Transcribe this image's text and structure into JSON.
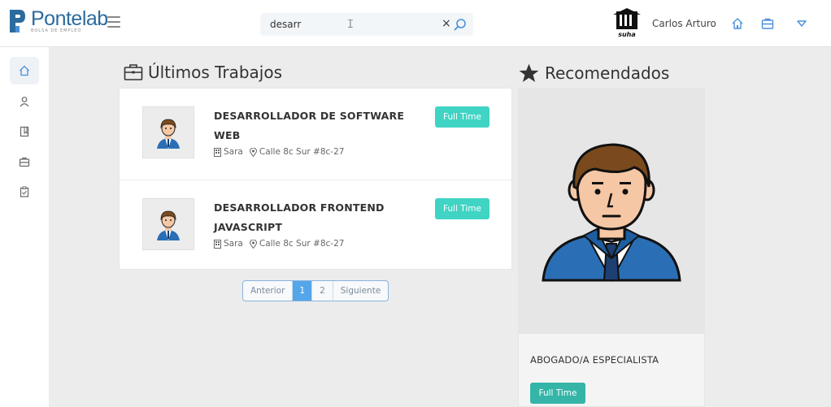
{
  "brand": {
    "name": "Pontelab",
    "tagline": "BOLSA DE EMPLEO"
  },
  "search": {
    "value": "desarr",
    "clear_symbol": "×"
  },
  "user": {
    "name": "Carlos Arturo",
    "avatar_text": "suha"
  },
  "colors": {
    "primary": "#2c6b9e",
    "accent_teal": "#3fd4c4",
    "page_active": "#54a6e9",
    "icon_blue": "#4a90d9"
  },
  "icons": {
    "top": [
      "home-icon",
      "briefcase-icon",
      "chevron-down-icon"
    ],
    "sidebar": [
      "home-icon",
      "user-icon",
      "book-icon",
      "briefcase-icon",
      "clipboard-icon"
    ]
  },
  "latest_jobs": {
    "title": "Últimos Trabajos",
    "jobs": [
      {
        "title_line1": "DESARROLLADOR DE SOFTWARE",
        "title_line2": "WEB",
        "company": "Sara",
        "address": "Calle 8c Sur #8c-27",
        "type": "Full Time"
      },
      {
        "title_line1": "DESARROLLADOR FRONTEND",
        "title_line2": "JAVASCRIPT",
        "company": "Sara",
        "address": "Calle 8c Sur #8c-27",
        "type": "Full Time"
      }
    ]
  },
  "pagination": {
    "prev": "Anterior",
    "pages": [
      "1",
      "2"
    ],
    "current": "1",
    "next": "Siguiente"
  },
  "recommended": {
    "title": "Recomendados",
    "item": {
      "title": "ABOGADO/A ESPECIALISTA",
      "type": "Full Time"
    }
  }
}
